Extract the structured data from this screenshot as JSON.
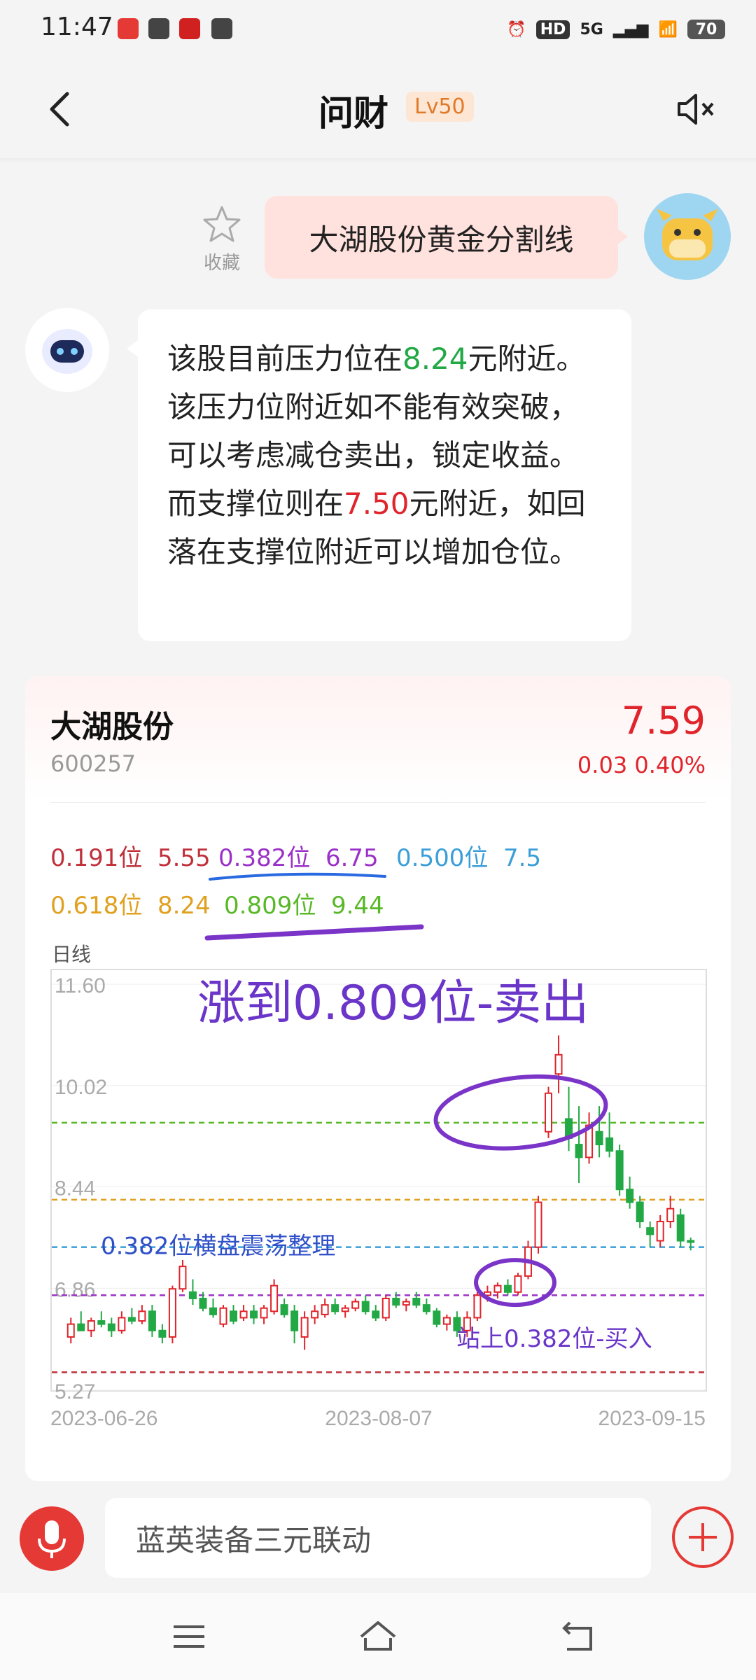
{
  "status_bar": {
    "time": "11:47",
    "battery": "70",
    "network": "5G",
    "hd": "HD"
  },
  "header": {
    "title": "问财",
    "level": "Lv50"
  },
  "user_message": {
    "favorite_label": "收藏",
    "text": "大湖股份黄金分割线"
  },
  "bot_message": {
    "parts": [
      {
        "text": "该股目前压力位在",
        "color": "normal"
      },
      {
        "text": "8.24",
        "color": "green"
      },
      {
        "text": "元附近。该压力位附近如不能有效突破，可以考虑减仓卖出，锁定收益。而支撑位则在",
        "color": "normal"
      },
      {
        "text": "7.50",
        "color": "red"
      },
      {
        "text": "元附近，如回落在支撑位附近可以增加仓位。",
        "color": "normal"
      }
    ]
  },
  "stock": {
    "name": "大湖股份",
    "code": "600257",
    "price": "7.59",
    "change": "0.03",
    "change_pct": "0.40%"
  },
  "fib_levels": [
    {
      "label": "0.191位",
      "value": "5.55",
      "color": "#c0303a"
    },
    {
      "label": "0.382位",
      "value": "6.75",
      "color": "#9b30c8"
    },
    {
      "label": "0.500位",
      "value": "7.5",
      "color": "#3a9ed8"
    },
    {
      "label": "0.618位",
      "value": "8.24",
      "color": "#e0a020"
    },
    {
      "label": "0.809位",
      "value": "9.44",
      "color": "#58b828"
    }
  ],
  "chart_label": "日线",
  "chart_data": {
    "type": "candlestick",
    "y_ticks": [
      "11.60",
      "10.02",
      "8.44",
      "6.86",
      "5.27"
    ],
    "ylim": [
      5.27,
      11.6
    ],
    "x_ticks": [
      "2023-06-26",
      "2023-08-07",
      "2023-09-15"
    ],
    "reference_lines": [
      {
        "level": "0.809位",
        "value": 9.44,
        "color": "#58b828"
      },
      {
        "level": "0.618位",
        "value": 8.24,
        "color": "#e0a020"
      },
      {
        "level": "0.500位",
        "value": 7.5,
        "color": "#3a9ed8"
      },
      {
        "level": "0.382位",
        "value": 6.75,
        "color": "#9b30c8"
      },
      {
        "level": "0.191位",
        "value": 5.55,
        "color": "#c0303a"
      }
    ],
    "candles": [
      {
        "o": 6.1,
        "h": 6.4,
        "l": 6.0,
        "c": 6.3
      },
      {
        "o": 6.3,
        "h": 6.5,
        "l": 6.2,
        "c": 6.2
      },
      {
        "o": 6.2,
        "h": 6.4,
        "l": 6.1,
        "c": 6.35
      },
      {
        "o": 6.35,
        "h": 6.5,
        "l": 6.25,
        "c": 6.3
      },
      {
        "o": 6.3,
        "h": 6.4,
        "l": 6.1,
        "c": 6.2
      },
      {
        "o": 6.2,
        "h": 6.5,
        "l": 6.15,
        "c": 6.4
      },
      {
        "o": 6.4,
        "h": 6.55,
        "l": 6.3,
        "c": 6.35
      },
      {
        "o": 6.35,
        "h": 6.6,
        "l": 6.3,
        "c": 6.5
      },
      {
        "o": 6.5,
        "h": 6.6,
        "l": 6.1,
        "c": 6.2
      },
      {
        "o": 6.2,
        "h": 6.3,
        "l": 6.0,
        "c": 6.1
      },
      {
        "o": 6.1,
        "h": 6.9,
        "l": 6.0,
        "c": 6.85
      },
      {
        "o": 6.85,
        "h": 7.3,
        "l": 6.8,
        "c": 7.2
      },
      {
        "o": 6.8,
        "h": 7.0,
        "l": 6.6,
        "c": 6.7
      },
      {
        "o": 6.7,
        "h": 6.8,
        "l": 6.5,
        "c": 6.55
      },
      {
        "o": 6.55,
        "h": 6.7,
        "l": 6.4,
        "c": 6.45
      },
      {
        "o": 6.3,
        "h": 6.6,
        "l": 6.25,
        "c": 6.55
      },
      {
        "o": 6.5,
        "h": 6.6,
        "l": 6.3,
        "c": 6.35
      },
      {
        "o": 6.4,
        "h": 6.6,
        "l": 6.35,
        "c": 6.5
      },
      {
        "o": 6.5,
        "h": 6.6,
        "l": 6.3,
        "c": 6.4
      },
      {
        "o": 6.4,
        "h": 6.6,
        "l": 6.3,
        "c": 6.55
      },
      {
        "o": 6.5,
        "h": 7.0,
        "l": 6.45,
        "c": 6.9
      },
      {
        "o": 6.6,
        "h": 6.7,
        "l": 6.4,
        "c": 6.45
      },
      {
        "o": 6.5,
        "h": 6.6,
        "l": 6.0,
        "c": 6.2
      },
      {
        "o": 6.1,
        "h": 6.5,
        "l": 5.9,
        "c": 6.4
      },
      {
        "o": 6.4,
        "h": 6.6,
        "l": 6.3,
        "c": 6.5
      },
      {
        "o": 6.45,
        "h": 6.7,
        "l": 6.4,
        "c": 6.6
      },
      {
        "o": 6.6,
        "h": 6.7,
        "l": 6.45,
        "c": 6.5
      },
      {
        "o": 6.5,
        "h": 6.6,
        "l": 6.4,
        "c": 6.55
      },
      {
        "o": 6.55,
        "h": 6.7,
        "l": 6.5,
        "c": 6.65
      },
      {
        "o": 6.65,
        "h": 6.75,
        "l": 6.45,
        "c": 6.5
      },
      {
        "o": 6.5,
        "h": 6.6,
        "l": 6.35,
        "c": 6.4
      },
      {
        "o": 6.4,
        "h": 6.75,
        "l": 6.35,
        "c": 6.7
      },
      {
        "o": 6.7,
        "h": 6.8,
        "l": 6.55,
        "c": 6.6
      },
      {
        "o": 6.6,
        "h": 6.7,
        "l": 6.5,
        "c": 6.65
      },
      {
        "o": 6.7,
        "h": 6.8,
        "l": 6.55,
        "c": 6.6
      },
      {
        "o": 6.6,
        "h": 6.7,
        "l": 6.45,
        "c": 6.5
      },
      {
        "o": 6.5,
        "h": 6.55,
        "l": 6.25,
        "c": 6.3
      },
      {
        "o": 6.3,
        "h": 6.45,
        "l": 6.2,
        "c": 6.4
      },
      {
        "o": 6.4,
        "h": 6.5,
        "l": 6.1,
        "c": 6.2
      },
      {
        "o": 6.2,
        "h": 6.5,
        "l": 6.1,
        "c": 6.4
      },
      {
        "o": 6.4,
        "h": 6.8,
        "l": 6.35,
        "c": 6.75
      },
      {
        "o": 6.75,
        "h": 6.9,
        "l": 6.65,
        "c": 6.8
      },
      {
        "o": 6.8,
        "h": 6.95,
        "l": 6.7,
        "c": 6.9
      },
      {
        "o": 6.9,
        "h": 7.0,
        "l": 6.75,
        "c": 6.8
      },
      {
        "o": 6.8,
        "h": 7.1,
        "l": 6.75,
        "c": 7.05
      },
      {
        "o": 7.05,
        "h": 7.6,
        "l": 7.0,
        "c": 7.5
      },
      {
        "o": 7.5,
        "h": 8.3,
        "l": 7.4,
        "c": 8.2
      },
      {
        "o": 9.3,
        "h": 10.0,
        "l": 9.2,
        "c": 9.9
      },
      {
        "o": 10.2,
        "h": 10.8,
        "l": 9.9,
        "c": 10.5
      },
      {
        "o": 9.5,
        "h": 10.0,
        "l": 9.0,
        "c": 9.2
      },
      {
        "o": 9.1,
        "h": 9.7,
        "l": 8.5,
        "c": 8.9
      },
      {
        "o": 8.9,
        "h": 9.6,
        "l": 8.8,
        "c": 9.4
      },
      {
        "o": 9.3,
        "h": 9.7,
        "l": 8.9,
        "c": 9.1
      },
      {
        "o": 9.2,
        "h": 9.6,
        "l": 8.9,
        "c": 9.0
      },
      {
        "o": 9.0,
        "h": 9.1,
        "l": 8.3,
        "c": 8.4
      },
      {
        "o": 8.4,
        "h": 8.6,
        "l": 8.1,
        "c": 8.2
      },
      {
        "o": 8.2,
        "h": 8.3,
        "l": 7.8,
        "c": 7.9
      },
      {
        "o": 7.8,
        "h": 7.9,
        "l": 7.5,
        "c": 7.7
      },
      {
        "o": 7.6,
        "h": 8.0,
        "l": 7.5,
        "c": 7.9
      },
      {
        "o": 7.9,
        "h": 8.3,
        "l": 7.8,
        "c": 8.1
      },
      {
        "o": 8.0,
        "h": 8.1,
        "l": 7.5,
        "c": 7.6
      },
      {
        "o": 7.6,
        "h": 7.65,
        "l": 7.45,
        "c": 7.59
      }
    ],
    "annotations": [
      {
        "text": "涨到0.809位-卖出",
        "color": "#6a35c8"
      },
      {
        "text": "0.382位横盘震荡整理",
        "color": "#3050c8"
      },
      {
        "text": "站上0.382位-买入",
        "color": "#6a35c8"
      }
    ]
  },
  "input": {
    "placeholder": "蓝英装备三元联动"
  },
  "colors": {
    "accent_red": "#e53935",
    "up": "#e0242b",
    "down": "#22a845"
  }
}
